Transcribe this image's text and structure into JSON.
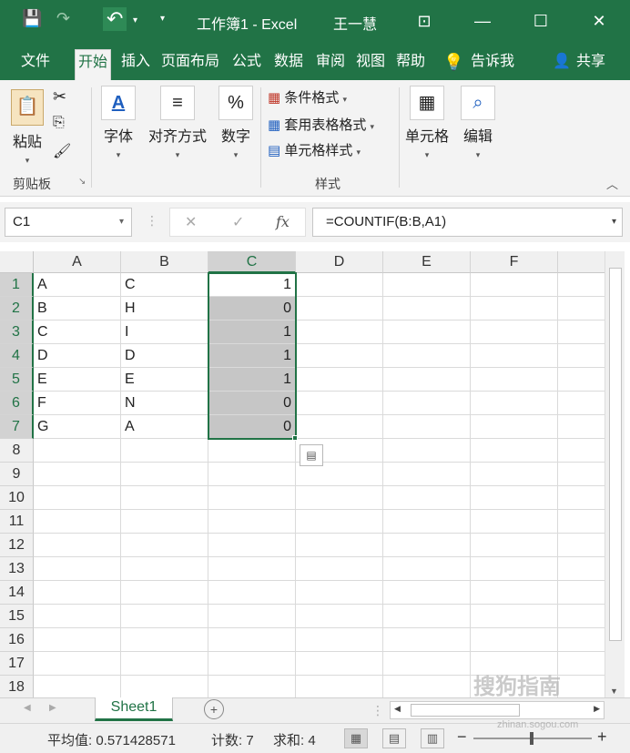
{
  "window": {
    "title": "工作簿1 - Excel",
    "user": "王一慧",
    "controls": {
      "restore_ribbon": "⊡",
      "minimize": "—",
      "maximize": "☐",
      "close": "✕"
    }
  },
  "tabs": [
    "文件",
    "开始",
    "插入",
    "页面布局",
    "公式",
    "数据",
    "审阅",
    "视图",
    "帮助"
  ],
  "active_tab": "开始",
  "tell_me": "告诉我",
  "share": "共享",
  "ribbon": {
    "clipboard": {
      "paste": "粘贴",
      "group": "剪贴板"
    },
    "font": "字体",
    "alignment": "对齐方式",
    "number": "数字",
    "styles": {
      "conditional": "条件格式",
      "table_format": "套用表格格式",
      "cell_styles": "单元格样式",
      "group": "样式"
    },
    "cells": "单元格",
    "editing": "编辑"
  },
  "formula_bar": {
    "name_box": "C1",
    "fx": "fx",
    "formula": "=COUNTIF(B:B,A1)"
  },
  "sheet": {
    "columns": [
      "A",
      "B",
      "C",
      "D",
      "E",
      "F"
    ],
    "selected_column": "C",
    "rows": [
      "1",
      "2",
      "3",
      "4",
      "5",
      "6",
      "7",
      "8",
      "9",
      "10",
      "11",
      "12",
      "13",
      "14",
      "15",
      "16",
      "17",
      "18"
    ],
    "data": [
      {
        "A": "A",
        "B": "C",
        "C": "1"
      },
      {
        "A": "B",
        "B": "H",
        "C": "0"
      },
      {
        "A": "C",
        "B": "I",
        "C": "1"
      },
      {
        "A": "D",
        "B": "D",
        "C": "1"
      },
      {
        "A": "E",
        "B": "E",
        "C": "1"
      },
      {
        "A": "F",
        "B": "N",
        "C": "0"
      },
      {
        "A": "G",
        "B": "A",
        "C": "0"
      }
    ]
  },
  "sheet_tab": "Sheet1",
  "status": {
    "average": "平均值: 0.571428571",
    "count": "计数: 7",
    "sum": "求和: 4"
  },
  "watermark": {
    "text": "搜狗指南",
    "url": "zhinan.sogou.com"
  },
  "colors": {
    "accent": "#217346",
    "selection": "#c6c6c6"
  }
}
